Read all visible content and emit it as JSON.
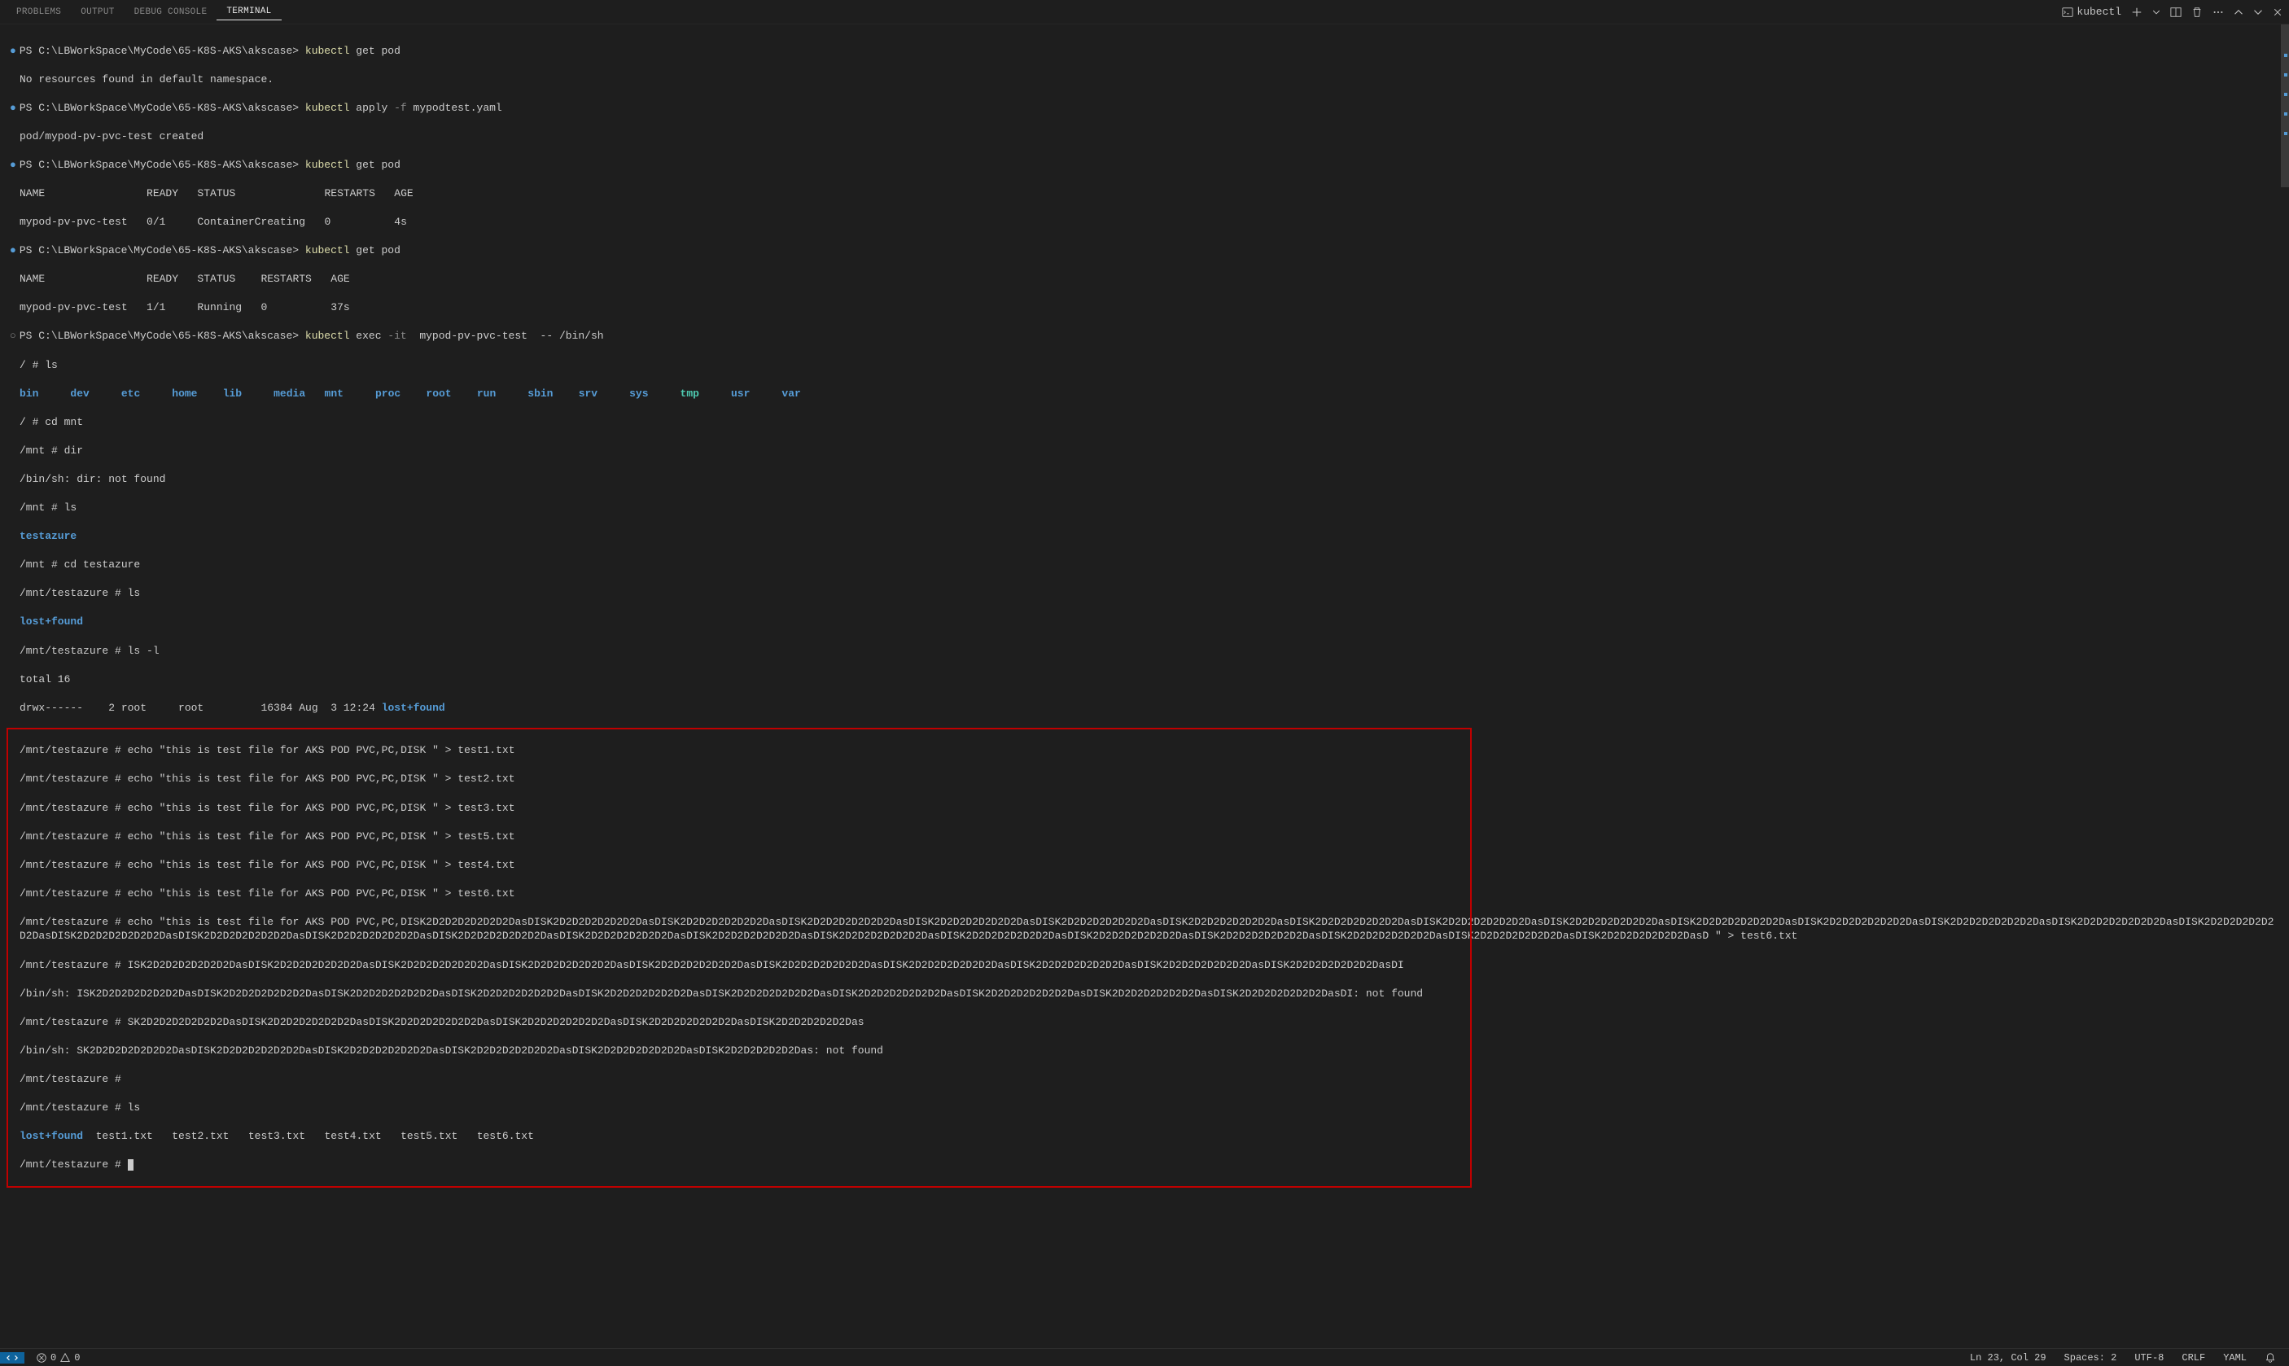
{
  "tabs": {
    "problems": "PROBLEMS",
    "output": "OUTPUT",
    "debug_console": "DEBUG CONSOLE",
    "terminal": "TERMINAL"
  },
  "panel_actions": {
    "shell_label": "kubectl"
  },
  "prompts": {
    "ps_prefix": "PS ",
    "path": "C:\\LBWorkSpace\\MyCode\\65-K8S-AKS\\akscase>",
    "cmd_get_pod": " get pod",
    "cmd_apply": " apply ",
    "flag_f": "-f",
    "apply_file": " mypodtest.yaml",
    "cmd_exec": " exec ",
    "flag_it": "-it",
    "exec_target": "  mypod-pv-pvc-test  -- /bin/sh",
    "kubectl": "kubectl"
  },
  "output": {
    "no_resources": "No resources found in default namespace.",
    "pod_created": "pod/mypod-pv-pvc-test created",
    "hdr1": "NAME                READY   STATUS              RESTARTS   AGE",
    "row1": "mypod-pv-pvc-test   0/1     ContainerCreating   0          4s",
    "hdr2": "NAME                READY   STATUS    RESTARTS   AGE",
    "row2": "mypod-pv-pvc-test   1/1     Running   0          37s",
    "shell_root": "/ # ",
    "ls": "ls",
    "dirs": [
      "bin",
      "dev",
      "etc",
      "home",
      "lib",
      "media",
      "mnt",
      "proc",
      "root",
      "run",
      "sbin",
      "srv",
      "sys",
      "tmp",
      "usr",
      "var"
    ],
    "cd_mnt": "/ # cd mnt",
    "mnt_prompt": "/mnt # ",
    "dir_cmd": "dir",
    "dir_err": "/bin/sh: dir: not found",
    "testazure": "testazure",
    "cd_testazure": "/mnt # cd testazure",
    "ta_prompt": "/mnt/testazure # ",
    "lostfound": "lost+found",
    "ls_l": "ls -l",
    "total": "total 16",
    "lsrow": "drwx------    2 root     root         16384 Aug  3 12:24 ",
    "echo_prefix": "/mnt/testazure # echo \"this is test file for AKS POD PVC,PC,DISK \" > ",
    "test1": "test1.txt",
    "test2": "test2.txt",
    "test3": "test3.txt",
    "test5": "test5.txt",
    "test4": "test4.txt",
    "test6": "test6.txt",
    "echo_long": "/mnt/testazure # echo \"this is test file for AKS POD PVC,PC,DISK2D2D2D2D2D2D2DasDISK2D2D2D2D2D2D2DasDISK2D2D2D2D2D2D2DasDISK2D2D2D2D2D2D2DasDISK2D2D2D2D2D2D2DasDISK2D2D2D2D2D2D2DasDISK2D2D2D2D2D2D2DasDISK2D2D2D2D2D2D2DasDISK2D2D2D2D2D2D2DasDISK2D2D2D2D2D2D2DasDISK2D2D2D2D2D2D2DasDISK2D2D2D2D2D2D2DasDISK2D2D2D2D2D2D2DasDISK2D2D2D2D2D2D2DasDISK2D2D2D2D2D2D2DasDISK2D2D2D2D2D2D2DasDISK2D2D2D2D2D2D2DasDISK2D2D2D2D2D2D2DasDISK2D2D2D2D2D2D2DasDISK2D2D2D2D2D2D2DasDISK2D2D2D2D2D2D2DasDISK2D2D2D2D2D2D2DasDISK2D2D2D2D2D2D2DasDISK2D2D2D2D2D2D2DasDISK2D2D2D2D2D2D2DasDISK2D2D2D2D2D2D2DasDISK2D2D2D2D2D2D2DasDISK2D2D2D2D2D2D2DasD \" > test6.txt",
    "bad1": "/mnt/testazure # ISK2D2D2D2D2D2D2DasDISK2D2D2D2D2D2D2DasDISK2D2D2D2D2D2D2DasDISK2D2D2D2D2D2D2DasDISK2D2D2D2D2D2D2DasDISK2D2D2D2D2D2D2DasDISK2D2D2D2D2D2D2DasDISK2D2D2D2D2D2D2DasDISK2D2D2D2D2D2D2DasDISK2D2D2D2D2D2D2DasDI",
    "bad1_err": "/bin/sh: ISK2D2D2D2D2D2D2DasDISK2D2D2D2D2D2D2DasDISK2D2D2D2D2D2D2DasDISK2D2D2D2D2D2D2DasDISK2D2D2D2D2D2D2DasDISK2D2D2D2D2D2D2DasDISK2D2D2D2D2D2D2DasDISK2D2D2D2D2D2D2DasDISK2D2D2D2D2D2D2DasDISK2D2D2D2D2D2D2DasDI: not found",
    "bad2": "/mnt/testazure # SK2D2D2D2D2D2D2DasDISK2D2D2D2D2D2D2DasDISK2D2D2D2D2D2D2DasDISK2D2D2D2D2D2D2DasDISK2D2D2D2D2D2D2DasDISK2D2D2D2D2D2Das",
    "bad2_err": "/bin/sh: SK2D2D2D2D2D2D2DasDISK2D2D2D2D2D2D2DasDISK2D2D2D2D2D2D2DasDISK2D2D2D2D2D2D2DasDISK2D2D2D2D2D2D2DasDISK2D2D2D2D2D2Das: not found",
    "empty_prompt": "/mnt/testazure # ",
    "ls_after": "/mnt/testazure # ls",
    "files_row1": "  test1.txt   test2.txt   test3.txt   test4.txt   test5.txt   test6.txt"
  },
  "statusbar": {
    "errors": "0",
    "warnings": "0",
    "line_col": "Ln 23, Col 29",
    "spaces": "Spaces: 2",
    "encoding": "UTF-8",
    "eol": "CRLF",
    "lang": "YAML"
  }
}
